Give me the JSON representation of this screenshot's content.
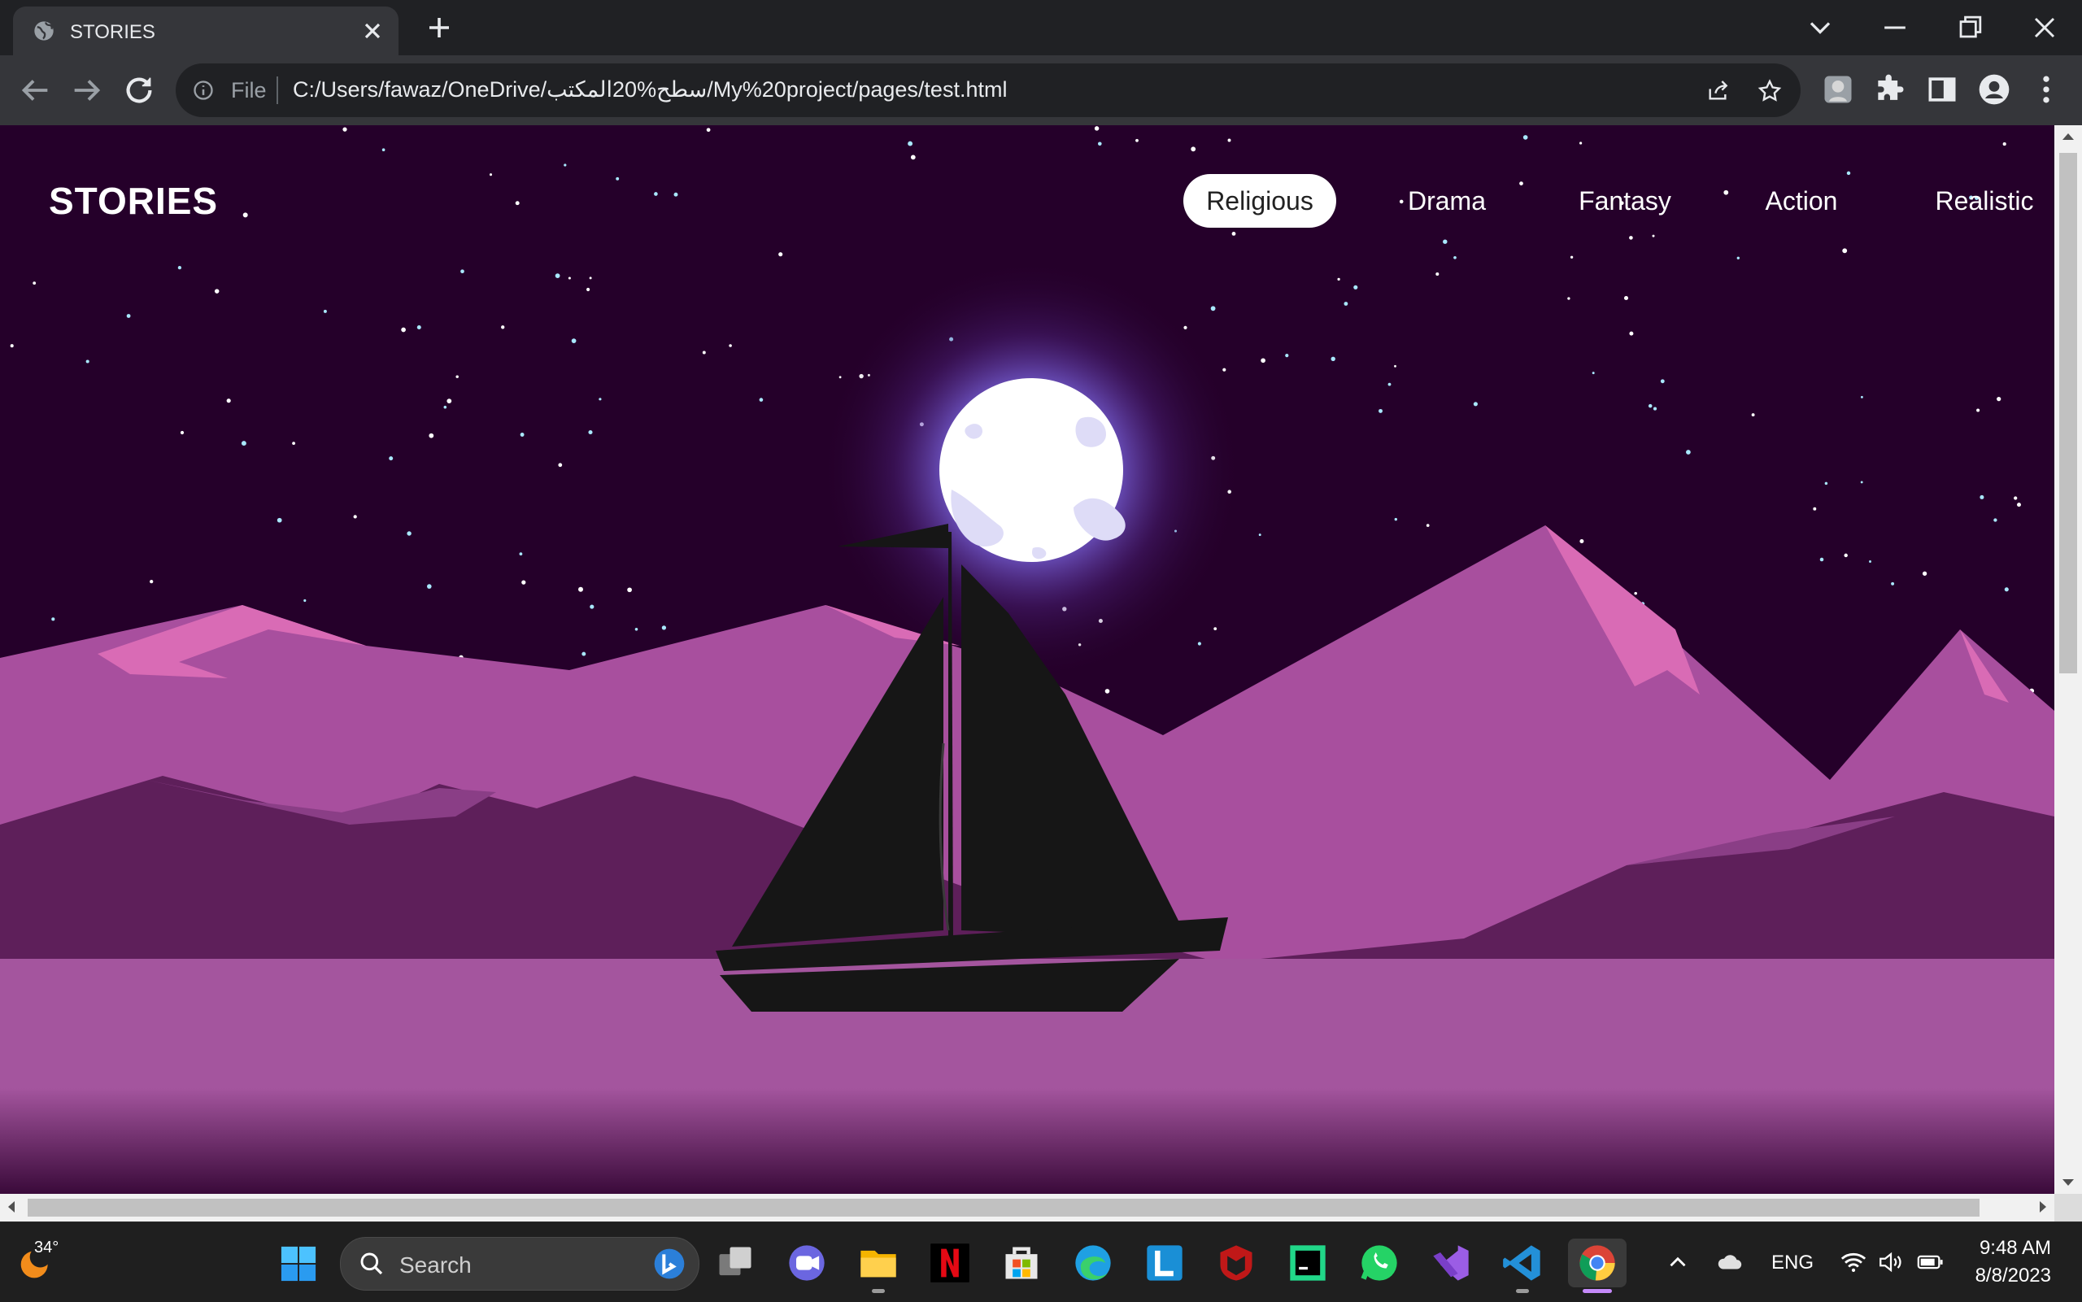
{
  "browser": {
    "tab_title": "STORIES",
    "address_scheme": "File",
    "address_url": "C:/Users/fawaz/OneDrive/سطح%20المكتب/My%20project/pages/test.html"
  },
  "page": {
    "logo": "STORIES",
    "nav": [
      {
        "label": "Religious",
        "active": true
      },
      {
        "label": "Drama",
        "active": false
      },
      {
        "label": "Fantasy",
        "active": false
      },
      {
        "label": "Action",
        "active": false
      },
      {
        "label": "Realistic",
        "active": false
      }
    ]
  },
  "colors": {
    "sky": "#25002a",
    "mountain_light": "#a84f9e",
    "mountain_highlight": "#d96bb5",
    "mountain_dark": "#5e1f5a",
    "water": "#a4559e",
    "boat": "#161616",
    "moon": "#ffffff",
    "moon_glow": "#8a79ff"
  },
  "taskbar": {
    "weather_temp": "34°",
    "search_placeholder": "Search",
    "language": "ENG",
    "time": "9:48 AM",
    "date": "8/8/2023",
    "apps": [
      "task-view",
      "teams-chat",
      "file-explorer",
      "netflix",
      "microsoft-store",
      "edge",
      "l-app",
      "mcafee",
      "pycharm",
      "whatsapp",
      "visual-studio",
      "vs-code",
      "chrome"
    ]
  }
}
